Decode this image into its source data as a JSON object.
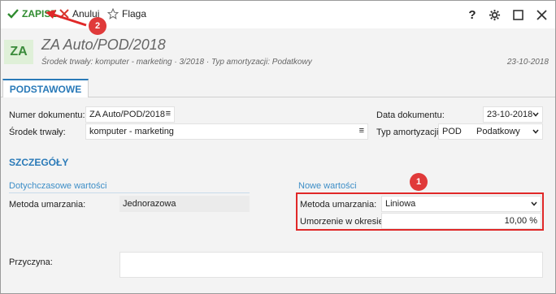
{
  "toolbar": {
    "save_label": "ZAPISZ",
    "cancel_label": "Anuluj",
    "flag_label": "Flaga",
    "help_label": "?"
  },
  "header": {
    "badge": "ZA",
    "title": "ZA Auto/POD/2018",
    "subtitle": "Środek trwały: komputer - marketing · 3/2018 · Typ amortyzacji: Podatkowy",
    "date": "23-10-2018"
  },
  "tabs": [
    {
      "label": "PODSTAWOWE"
    }
  ],
  "form": {
    "doc_number_label": "Numer dokumentu:",
    "doc_number_value": "ZA Auto/POD/2018",
    "asset_label": "Środek trwały:",
    "asset_value": "komputer - marketing",
    "doc_date_label": "Data dokumentu:",
    "doc_date_value": "23-10-2018",
    "amort_type_label": "Typ amortyzacji:",
    "amort_type_code": "POD",
    "amort_type_value": "Podatkowy"
  },
  "details": {
    "section_title": "SZCZEGÓŁY",
    "previous_heading": "Dotychczasowe wartości",
    "new_heading": "Nowe wartości",
    "method_label": "Metoda umarzania:",
    "previous_method_value": "Jednorazowa",
    "new_method_label": "Metoda umarzania:",
    "new_method_value": "Liniowa",
    "period_label": "Umorzenie w okresie:",
    "period_value": "10,00 %",
    "reason_label": "Przyczyna:",
    "reason_value": ""
  },
  "annotations": {
    "marker1": "1",
    "marker2": "2"
  },
  "colors": {
    "accent": "#2a7ab8",
    "save_green": "#2e8b2e",
    "cancel_red": "#d9342b",
    "annotation_red": "#e02828"
  }
}
